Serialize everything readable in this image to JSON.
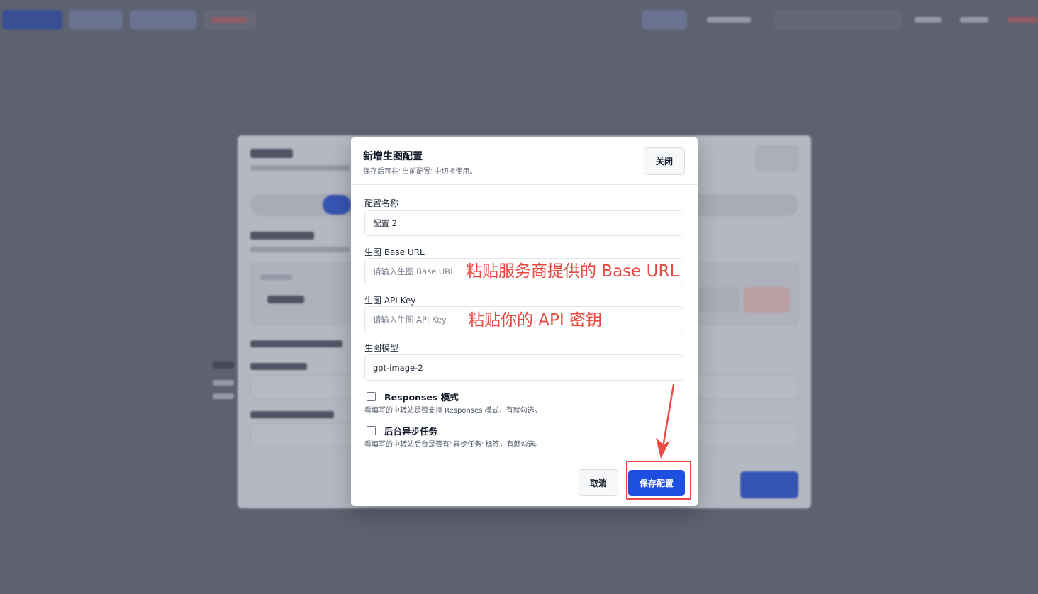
{
  "modal": {
    "title": "新增生图配置",
    "subtitle": "保存后可在“当前配置”中切换使用。",
    "close_label": "关闭",
    "fields": {
      "config_name": {
        "label": "配置名称",
        "value": "配置 2"
      },
      "base_url": {
        "label": "生图 Base URL",
        "placeholder": "请输入生图 Base URL",
        "value": ""
      },
      "api_key": {
        "label": "生图 API Key",
        "placeholder": "请输入生图 API Key",
        "value": ""
      },
      "model": {
        "label": "生图模型",
        "value": "gpt-image-2"
      }
    },
    "checkboxes": {
      "responses_mode": {
        "label": "Responses 模式",
        "help": "看填写的中转站是否支持 Responses 模式，有就勾选。",
        "checked": false
      },
      "async_task": {
        "label": "后台异步任务",
        "help": "看填写的中转站后台是否有“异步任务”标签，有就勾选。",
        "checked": false
      }
    },
    "cancel_label": "取消",
    "save_label": "保存配置"
  },
  "annotations": {
    "base_url_hint": "粘贴服务商提供的 Base URL",
    "api_key_hint": "粘贴你的 API 密钥"
  },
  "colors": {
    "overlay": "#5d6170",
    "primary": "#1f4fe0",
    "annotation": "#e8483f",
    "danger": "#e04848"
  },
  "icons": {
    "checkbox_off": "checkbox-empty-icon",
    "pointer_arrow": "red-arrow-icon"
  }
}
